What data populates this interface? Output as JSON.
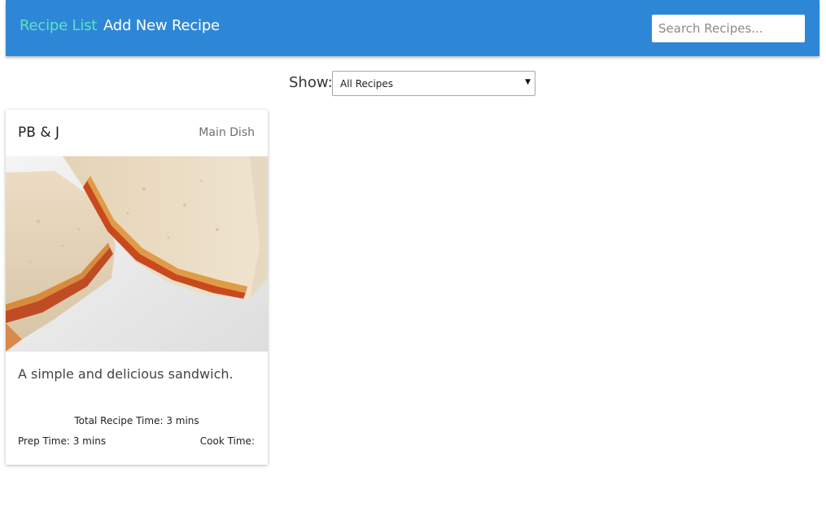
{
  "nav": {
    "links": [
      {
        "label": "Recipe List",
        "active": true
      },
      {
        "label": "Add New Recipe",
        "active": false
      }
    ],
    "search_placeholder": "Search Recipes..."
  },
  "filter": {
    "label": "Show:",
    "selected": "All Recipes"
  },
  "recipes": [
    {
      "title": "PB & J",
      "category": "Main Dish",
      "description": "A simple and delicious sandwich.",
      "total_time": "Total Recipe Time: 3 mins",
      "prep_time": "Prep Time: 3 mins",
      "cook_time": "Cook Time:"
    }
  ],
  "colors": {
    "navbar": "#2e87d6",
    "active_link": "#5fe0c6",
    "link": "#ffffff"
  }
}
